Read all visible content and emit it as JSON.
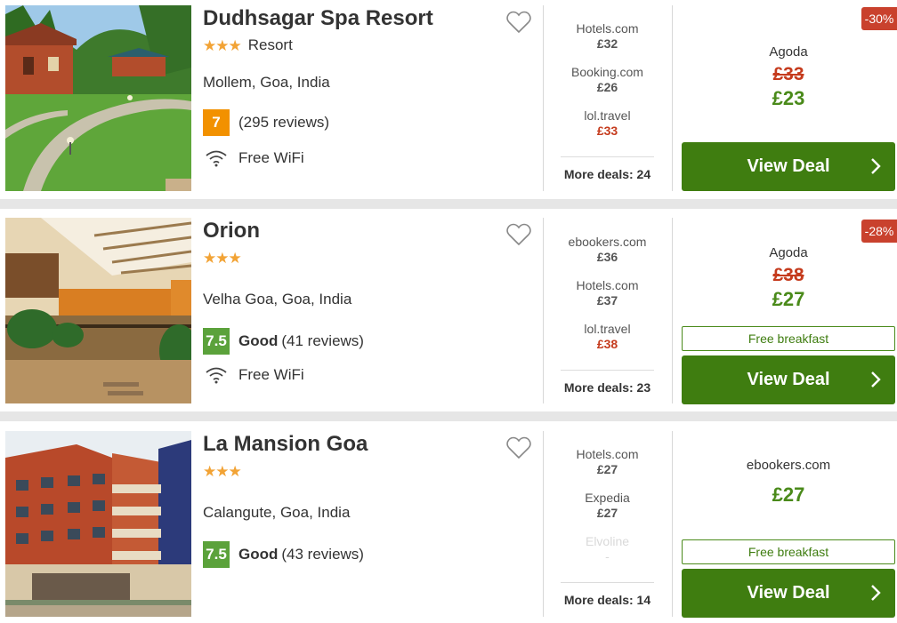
{
  "hotels": [
    {
      "name": "Dudhsagar Spa Resort",
      "stars": "★★★",
      "property_type": "Resort",
      "location": "Mollem, Goa, India",
      "score": "7",
      "score_color": "#f29100",
      "rating_label": "",
      "reviews": "(295 reviews)",
      "amenity": "Free WiFi",
      "deals": [
        {
          "provider": "Hotels.com",
          "price": "£32"
        },
        {
          "provider": "Booking.com",
          "price": "£26"
        },
        {
          "provider": "lol.travel",
          "price": "£33"
        }
      ],
      "more_deals": "More deals: 24",
      "best_provider": "Agoda",
      "old_price": "£33",
      "new_price": "£23",
      "discount": "-30%",
      "free_breakfast": "",
      "cta": "View Deal"
    },
    {
      "name": "Orion",
      "stars": "★★★",
      "property_type": "",
      "location": "Velha Goa, Goa, India",
      "score": "7.5",
      "score_color": "#5ba23b",
      "rating_label": "Good",
      "reviews": "(41 reviews)",
      "amenity": "Free WiFi",
      "deals": [
        {
          "provider": "ebookers.com",
          "price": "£36"
        },
        {
          "provider": "Hotels.com",
          "price": "£37"
        },
        {
          "provider": "lol.travel",
          "price": "£38"
        }
      ],
      "more_deals": "More deals: 23",
      "best_provider": "Agoda",
      "old_price": "£38",
      "new_price": "£27",
      "discount": "-28%",
      "free_breakfast": "Free breakfast",
      "cta": "View Deal"
    },
    {
      "name": "La Mansion Goa",
      "stars": "★★★",
      "property_type": "",
      "location": "Calangute, Goa, India",
      "score": "7.5",
      "score_color": "#5ba23b",
      "rating_label": "Good",
      "reviews": "(43 reviews)",
      "amenity": "",
      "deals": [
        {
          "provider": "Hotels.com",
          "price": "£27"
        },
        {
          "provider": "Expedia",
          "price": "£27"
        },
        {
          "provider": "Elvoline",
          "price": "-"
        }
      ],
      "more_deals": "More deals: 14",
      "best_provider": "ebookers.com",
      "old_price": "",
      "new_price": "£27",
      "discount": "",
      "free_breakfast": "Free breakfast",
      "cta": "View Deal"
    }
  ],
  "colors": {
    "view_deal_green": "#3f7d10",
    "price_green": "#4a8a1a",
    "price_red": "#c53b1d",
    "star_orange": "#f2a335",
    "discount_red": "#c9412d"
  }
}
